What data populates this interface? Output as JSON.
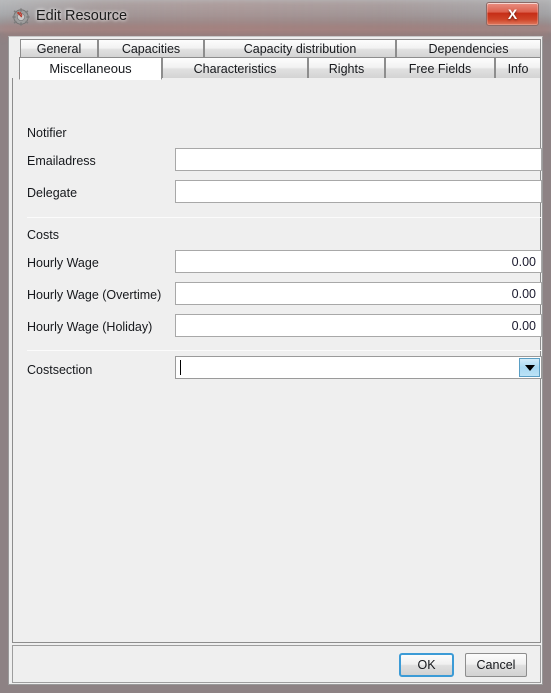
{
  "window": {
    "title": "Edit Resource",
    "icon": "gear-icon",
    "close_label": "X",
    "accent_blue": "#3c9bd6",
    "close_red": "#c52d16"
  },
  "tabs": {
    "row1": [
      {
        "label": "General",
        "selected": false
      },
      {
        "label": "Capacities",
        "selected": false
      },
      {
        "label": "Capacity distribution",
        "selected": false
      },
      {
        "label": "Dependencies",
        "selected": false
      }
    ],
    "row2": [
      {
        "label": "Miscellaneous",
        "selected": true
      },
      {
        "label": "Characteristics",
        "selected": false
      },
      {
        "label": "Rights",
        "selected": false
      },
      {
        "label": "Free Fields",
        "selected": false
      },
      {
        "label": "Info",
        "selected": false
      }
    ]
  },
  "form": {
    "notifier_section": "Notifier",
    "emailadress_label": "Emailadress",
    "emailadress_value": "",
    "delegate_label": "Delegate",
    "delegate_value": "",
    "costs_section": "Costs",
    "hourly_wage_label": "Hourly Wage",
    "hourly_wage_value": "0.00",
    "hourly_wage_overtime_label": "Hourly Wage (Overtime)",
    "hourly_wage_overtime_value": "0.00",
    "hourly_wage_holiday_label": "Hourly Wage (Holiday)",
    "hourly_wage_holiday_value": "0.00",
    "costsection_label": "Costsection",
    "costsection_value": ""
  },
  "buttons": {
    "ok": "OK",
    "cancel": "Cancel"
  }
}
